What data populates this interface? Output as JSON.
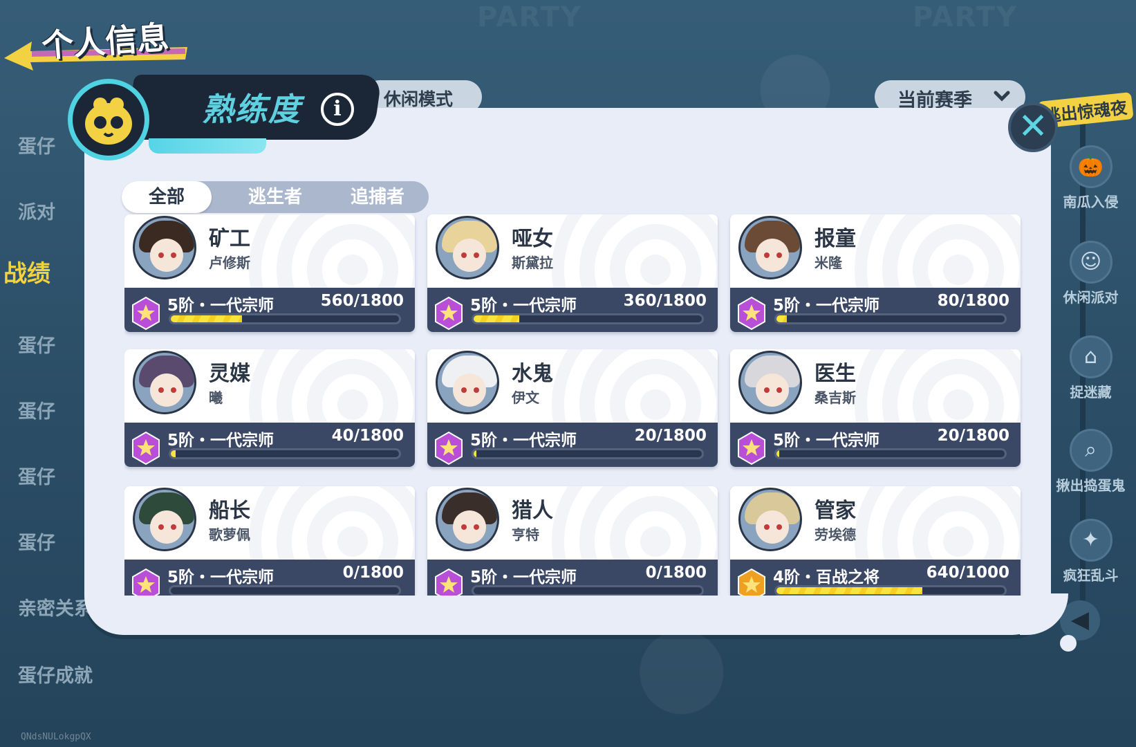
{
  "page": {
    "title": "个人信息",
    "watermark": "QNdsNULokgpQX",
    "side_nav": [
      {
        "label": "蛋仔",
        "active": false
      },
      {
        "label": "派对",
        "active": false
      },
      {
        "label": "战绩",
        "active": true
      },
      {
        "label": "蛋仔",
        "active": false
      },
      {
        "label": "蛋仔",
        "active": false
      },
      {
        "label": "蛋仔",
        "active": false
      },
      {
        "label": "蛋仔",
        "active": false
      },
      {
        "label": "亲密关系",
        "active": false
      },
      {
        "label": "蛋仔成就",
        "active": false
      }
    ],
    "mode_pill": "休闲模式",
    "season_dropdown": "当前赛季",
    "rail": {
      "top_label": "逃出惊魂夜",
      "items": [
        {
          "label": "南瓜入侵",
          "icon": "pumpkin-icon"
        },
        {
          "label": "休闲派对",
          "icon": "party-icon"
        },
        {
          "label": "捉迷藏",
          "icon": "hide-seek-icon"
        },
        {
          "label": "揪出捣蛋鬼",
          "icon": "magnifier-icon"
        },
        {
          "label": "疯狂乱斗",
          "icon": "brawl-icon"
        }
      ]
    }
  },
  "modal": {
    "title": "熟练度",
    "tabs": [
      {
        "label": "全部",
        "active": true
      },
      {
        "label": "逃生者",
        "active": false
      },
      {
        "label": "追捕者",
        "active": false
      }
    ],
    "cards": [
      {
        "name": "矿工",
        "person": "卢修斯",
        "rank": "5阶・一代宗师",
        "progress": "560/1800",
        "fraction": 0.311,
        "badge": "purple",
        "hair": "#3b2a22"
      },
      {
        "name": "哑女",
        "person": "斯黛拉",
        "rank": "5阶・一代宗师",
        "progress": "360/1800",
        "fraction": 0.2,
        "badge": "purple",
        "hair": "#e8d49a"
      },
      {
        "name": "报童",
        "person": "米隆",
        "rank": "5阶・一代宗师",
        "progress": "80/1800",
        "fraction": 0.044,
        "badge": "purple",
        "hair": "#6b4a36"
      },
      {
        "name": "灵媒",
        "person": "曦",
        "rank": "5阶・一代宗师",
        "progress": "40/1800",
        "fraction": 0.022,
        "badge": "purple",
        "hair": "#5a4a6e"
      },
      {
        "name": "水鬼",
        "person": "伊文",
        "rank": "5阶・一代宗师",
        "progress": "20/1800",
        "fraction": 0.011,
        "badge": "purple",
        "hair": "#eef0f4"
      },
      {
        "name": "医生",
        "person": "桑吉斯",
        "rank": "5阶・一代宗师",
        "progress": "20/1800",
        "fraction": 0.011,
        "badge": "purple",
        "hair": "#d8d8dc"
      },
      {
        "name": "船长",
        "person": "歌萝佩",
        "rank": "5阶・一代宗师",
        "progress": "0/1800",
        "fraction": 0,
        "badge": "purple",
        "hair": "#2e4a3a"
      },
      {
        "name": "猎人",
        "person": "亨特",
        "rank": "5阶・一代宗师",
        "progress": "0/1800",
        "fraction": 0,
        "badge": "purple",
        "hair": "#3a2e2a"
      },
      {
        "name": "管家",
        "person": "劳埃德",
        "rank": "4阶・百战之将",
        "progress": "640/1000",
        "fraction": 0.64,
        "badge": "gold",
        "hair": "#d9c89a"
      }
    ]
  },
  "colors": {
    "accent": "#5fd0e0",
    "progress": "#f8e43a",
    "rank_bar": "#3a4765",
    "badge_purple": "#b84fd6",
    "badge_gold": "#f0a020"
  }
}
